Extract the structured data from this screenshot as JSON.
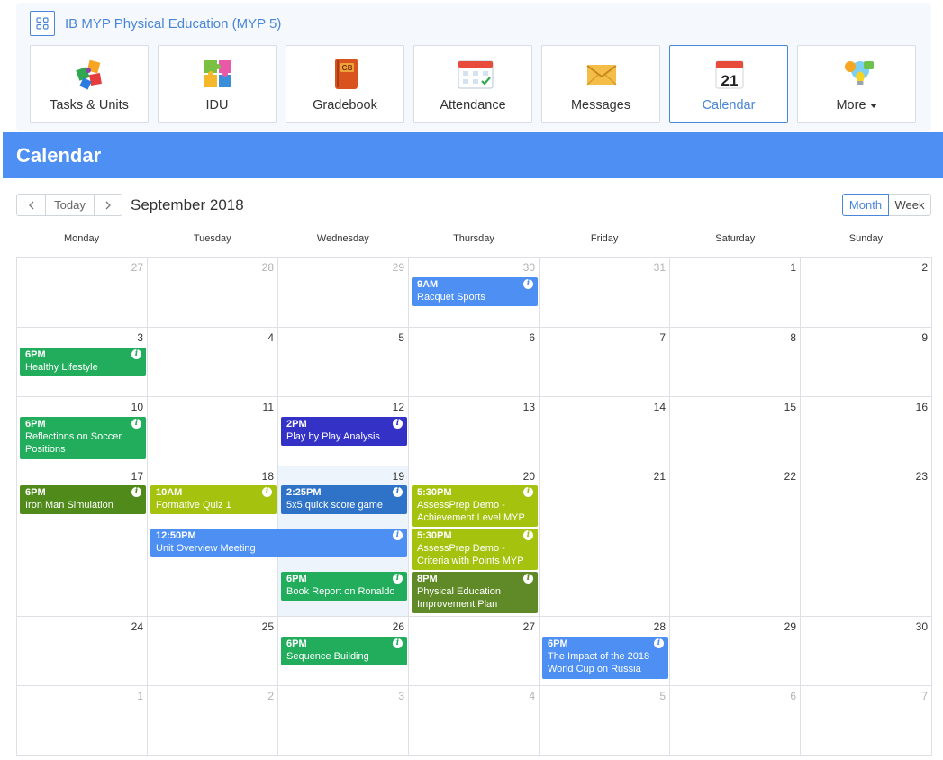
{
  "course": {
    "title": "IB MYP Physical Education (MYP 5)",
    "menu_icon": "grid-apps-icon"
  },
  "tiles": [
    {
      "label": "Tasks & Units",
      "icon": "puzzle-icon",
      "active": false
    },
    {
      "label": "IDU",
      "icon": "puzzle-pieces-icon",
      "active": false
    },
    {
      "label": "Gradebook",
      "icon": "gradebook-icon",
      "active": false
    },
    {
      "label": "Attendance",
      "icon": "attendance-icon",
      "active": false
    },
    {
      "label": "Messages",
      "icon": "envelope-icon",
      "active": false
    },
    {
      "label": "Calendar",
      "icon": "calendar-icon",
      "active": true
    },
    {
      "label": "More",
      "icon": "more-bulb-icon",
      "active": false,
      "dropdown": true
    }
  ],
  "tile_icon_text": {
    "gradebook": "GB",
    "calendar_day": "21"
  },
  "banner": {
    "title": "Calendar"
  },
  "toolbar": {
    "prev_icon": "chevron-left-icon",
    "today_label": "Today",
    "next_icon": "chevron-right-icon",
    "month_label": "September 2018",
    "views": [
      "Month",
      "Week"
    ],
    "active_view": "Month"
  },
  "weekdays": [
    "Monday",
    "Tuesday",
    "Wednesday",
    "Thursday",
    "Friday",
    "Saturday",
    "Sunday"
  ],
  "weeks": [
    [
      "27",
      "28",
      "29",
      "30",
      "31",
      "1",
      "2"
    ],
    [
      "3",
      "4",
      "5",
      "6",
      "7",
      "8",
      "9"
    ],
    [
      "10",
      "11",
      "12",
      "13",
      "14",
      "15",
      "16"
    ],
    [
      "17",
      "18",
      "19",
      "20",
      "21",
      "22",
      "23"
    ],
    [
      "24",
      "25",
      "26",
      "27",
      "28",
      "29",
      "30"
    ],
    [
      "1",
      "2",
      "3",
      "4",
      "5",
      "6",
      "7"
    ]
  ],
  "colors": {
    "primary": "#4a86d8",
    "banner": "#4d8ff3",
    "event_blue": "#4d8ff3",
    "event_green": "#22ad5c",
    "event_indigo": "#3431c7",
    "event_darkgreen": "#4f8a1a",
    "event_lime": "#a5c20f",
    "event_steel": "#2f73c8",
    "event_olive": "#5f8a27",
    "today_bg": "#edf4fc"
  },
  "events": [
    {
      "time": "9AM",
      "title": "Racquet Sports",
      "color": "#4d8ff3"
    },
    {
      "time": "6PM",
      "title": "Healthy Lifestyle",
      "color": "#22ad5c"
    },
    {
      "time": "6PM",
      "title": "Reflections on Soccer Positions",
      "color": "#22ad5c"
    },
    {
      "time": "2PM",
      "title": "Play by Play Analysis",
      "color": "#3431c7"
    },
    {
      "time": "6PM",
      "title": "Iron Man Simulation",
      "color": "#4f8a1a"
    },
    {
      "time": "10AM",
      "title": "Formative Quiz 1",
      "color": "#a5c20f"
    },
    {
      "time": "2:25PM",
      "title": "5x5 quick score game",
      "color": "#2f73c8"
    },
    {
      "time": "5:30PM",
      "title": "AssessPrep Demo - Achievement Level MYP",
      "color": "#a5c20f"
    },
    {
      "time": "12:50PM",
      "title": "Unit Overview Meeting",
      "color": "#4d8ff3"
    },
    {
      "time": "5:30PM",
      "title": "AssessPrep Demo - Criteria with Points MYP",
      "color": "#a5c20f"
    },
    {
      "time": "6PM",
      "title": "Book Report on Ronaldo",
      "color": "#22ad5c"
    },
    {
      "time": "8PM",
      "title": "Physical Education Improvement Plan",
      "color": "#5f8a27"
    },
    {
      "time": "6PM",
      "title": "Sequence Building",
      "color": "#22ad5c"
    },
    {
      "time": "6PM",
      "title": "The Impact of the 2018 World Cup on Russia",
      "color": "#4d8ff3"
    }
  ]
}
